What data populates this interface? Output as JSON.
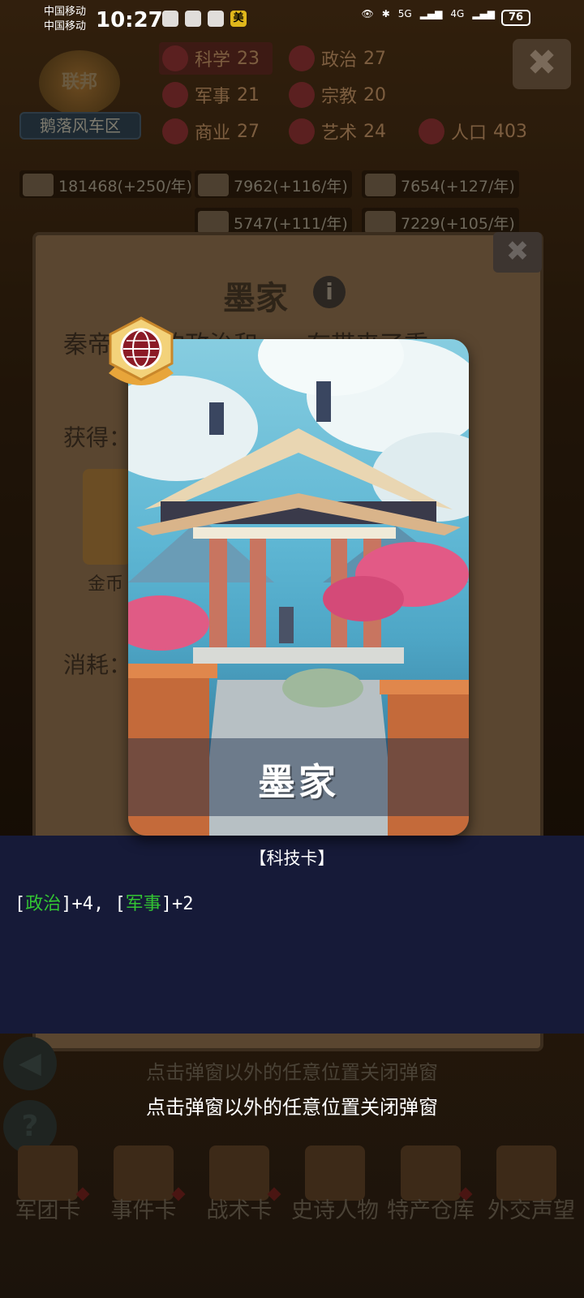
{
  "status_bar": {
    "carrier_1": "中国移动",
    "carrier_2": "中国移动",
    "time": "10:27",
    "app_badge": "美",
    "network_1": "5G",
    "network_2": "4G",
    "battery": "76"
  },
  "header": {
    "emblem_text": "联邦",
    "region": "鹅落风车区",
    "stats": [
      {
        "label": "科学",
        "value": "23"
      },
      {
        "label": "政治",
        "value": "27"
      },
      {
        "label": "军事",
        "value": "21"
      },
      {
        "label": "宗教",
        "value": "20"
      },
      {
        "label": "商业",
        "value": "27"
      },
      {
        "label": "艺术",
        "value": "24"
      },
      {
        "label": "人口",
        "value": "403"
      }
    ],
    "resources": [
      "181468(+250/年)",
      "7962(+116/年)",
      "7654(+127/年)",
      "5747(+111/年)",
      "7229(+105/年)"
    ],
    "close_glyph": "✖"
  },
  "panel": {
    "title": "墨家",
    "info_glyph": "i",
    "description": "秦帝……的政治和……存带来了重",
    "gain_label": "获得：",
    "coin_label": "金币",
    "cost_label": "消耗：",
    "close_glyph": "✖"
  },
  "card": {
    "name": "墨家",
    "type_label": "【科技卡】",
    "effects": {
      "open": "[",
      "stat1": "政治",
      "mid1": "]+4, [",
      "stat2": "军事",
      "mid2": "]+2"
    }
  },
  "close_hint": "点击弹窗以外的任意位置关闭弹窗",
  "side_buttons": {
    "sound_glyph": "◀",
    "help_glyph": "?"
  },
  "bottom_nav": [
    {
      "label": "军团卡"
    },
    {
      "label": "事件卡"
    },
    {
      "label": "战术卡"
    },
    {
      "label": "史诗人物"
    },
    {
      "label": "特产仓库"
    },
    {
      "label": "外交声望"
    }
  ]
}
